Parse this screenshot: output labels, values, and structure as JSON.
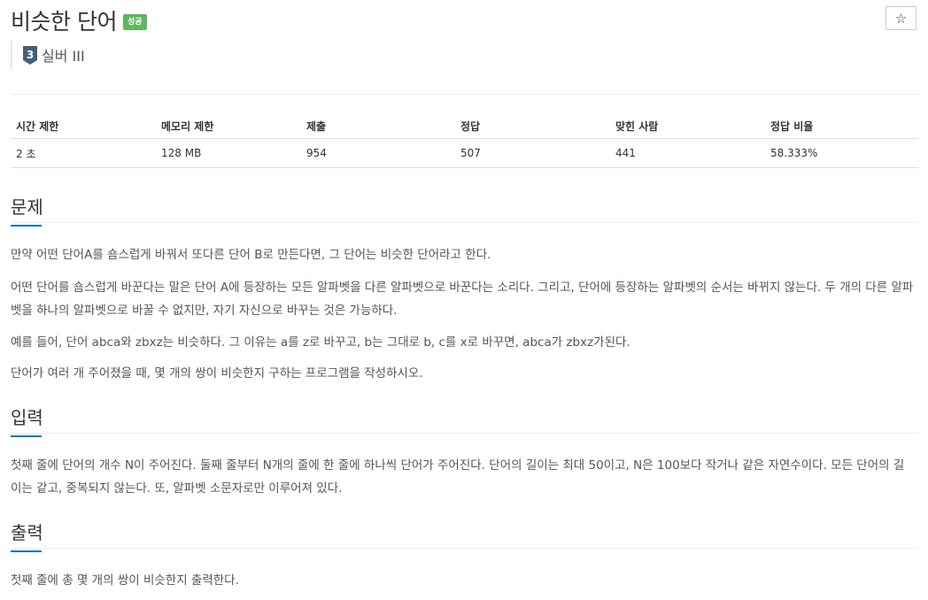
{
  "problem": {
    "title": "비슷한 단어",
    "status_badge": "성공",
    "tier_number": "3",
    "tier_label": "실버 III",
    "star_icon": "☆"
  },
  "info_table": {
    "headers": [
      "시간 제한",
      "메모리 제한",
      "제출",
      "정답",
      "맞힌 사람",
      "정답 비율"
    ],
    "values": [
      "2 초",
      "128 MB",
      "954",
      "507",
      "441",
      "58.333%"
    ]
  },
  "sections": {
    "problem": {
      "title": "문제",
      "paragraphs": [
        "만약 어떤 단어A를 숌스럽게 바꿔서 또다른 단어 B로 만든다면, 그 단어는 비슷한 단어라고 한다.",
        "어떤 단어를 숌스럽게 바꾼다는 말은 단어 A에 등장하는 모든 알파벳을 다른 알파벳으로 바꾼다는 소리다. 그리고, 단어에 등장하는 알파벳의 순서는 바뀌지 않는다. 두 개의 다른 알파벳을 하나의 알파벳으로 바꿀 수 없지만, 자기 자신으로 바꾸는 것은 가능하다.",
        "예를 들어, 단어 abca와 zbxz는 비슷하다. 그 이유는 a를 z로 바꾸고, b는 그대로 b, c를 x로 바꾸면, abca가 zbxz가된다.",
        "단어가 여러 개 주어졌을 때, 몇 개의 쌍이 비슷한지 구하는 프로그램을 작성하시오."
      ]
    },
    "input": {
      "title": "입력",
      "paragraphs": [
        "첫째 줄에 단어의 개수 N이 주어진다. 둘째 줄부터 N개의 줄에 한 줄에 하나씩 단어가 주어진다. 단어의 길이는 최대 50이고, N은 100보다 작거나 같은 자연수이다. 모든 단어의 길이는 같고, 중복되지 않는다. 또, 알파벳 소문자로만 이루어져 있다."
      ]
    },
    "output": {
      "title": "출력",
      "paragraphs": [
        "첫째 줄에 총 몇 개의 쌍이 비슷한지 출력한다."
      ]
    }
  },
  "colors": {
    "badge_success": "#5cb85c",
    "section_underline": "#0076c0",
    "tier_silver": "#435f7a"
  }
}
